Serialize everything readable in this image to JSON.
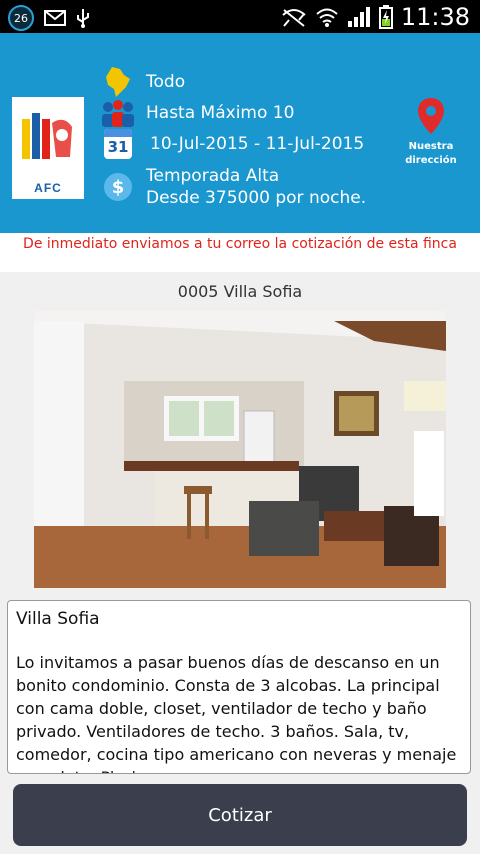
{
  "status_bar": {
    "notification_count": "26",
    "time": "11:38"
  },
  "header": {
    "logo_text": "AFC",
    "destination": "Todo",
    "guests": "Hasta Máximo 10",
    "calendar_day": "31",
    "dates": "10-Jul-2015 - 11-Jul-2015",
    "season": "Temporada Alta",
    "price": "Desde 375000 por noche.",
    "location_label_1": "Nuestra",
    "location_label_2": "dirección"
  },
  "notice": "De inmediato enviamos a tu correo la cotización de esta finca",
  "property": {
    "code_title": "0005 Villa Sofia",
    "name": "Villa Sofia",
    "description": "Lo invitamos a pasar buenos días de descanso en un bonito condominio. Consta de 3 alcobas. La principal con cama doble, closet, ventilador de techo y baño privado. Ventiladores de techo. 3 baños. Sala, tv, comedor, cocina tipo americano con neveras y menaje completo. Piscina"
  },
  "actions": {
    "quote_button": "Cotizar"
  },
  "colors": {
    "header_bg": "#1b97cf",
    "notice_text": "#e2231a",
    "button_bg": "#3b3f4d",
    "pin_red": "#e02b2b"
  },
  "icons": [
    "notification-badge",
    "mail-icon",
    "usb-icon",
    "wifi-off-icon",
    "wifi-icon",
    "signal-icon",
    "battery-icon",
    "colombia-map-icon",
    "people-icon",
    "calendar-icon",
    "dollar-icon",
    "location-pin-icon"
  ]
}
